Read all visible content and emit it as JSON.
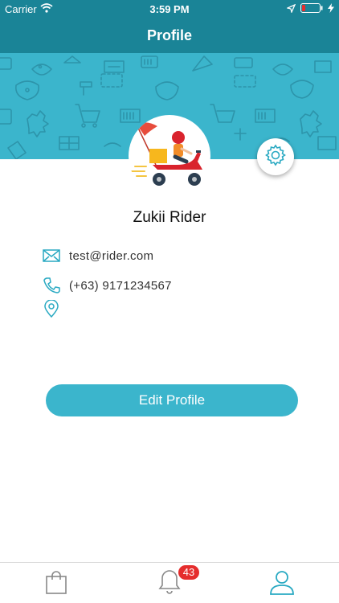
{
  "status_bar": {
    "carrier": "Carrier",
    "time": "3:59 PM"
  },
  "nav": {
    "title": "Profile"
  },
  "profile": {
    "name": "Zukii Rider",
    "email": "test@rider.com",
    "phone": "(+63) 9171234567",
    "location": ""
  },
  "actions": {
    "edit_label": "Edit Profile"
  },
  "tabbar": {
    "notification_count": "43"
  },
  "colors": {
    "nav_bg": "#1a8497",
    "banner_bg": "#3bb5cc",
    "accent": "#3bb5cc",
    "badge": "#e52d2d",
    "icon": "#29a9c2"
  },
  "icons": [
    "wifi-icon",
    "location-arrow-icon",
    "battery-icon",
    "charging-icon",
    "gear-icon",
    "mail-icon",
    "phone-icon",
    "map-pin-icon",
    "shopping-bag-icon",
    "bell-icon",
    "user-icon"
  ]
}
